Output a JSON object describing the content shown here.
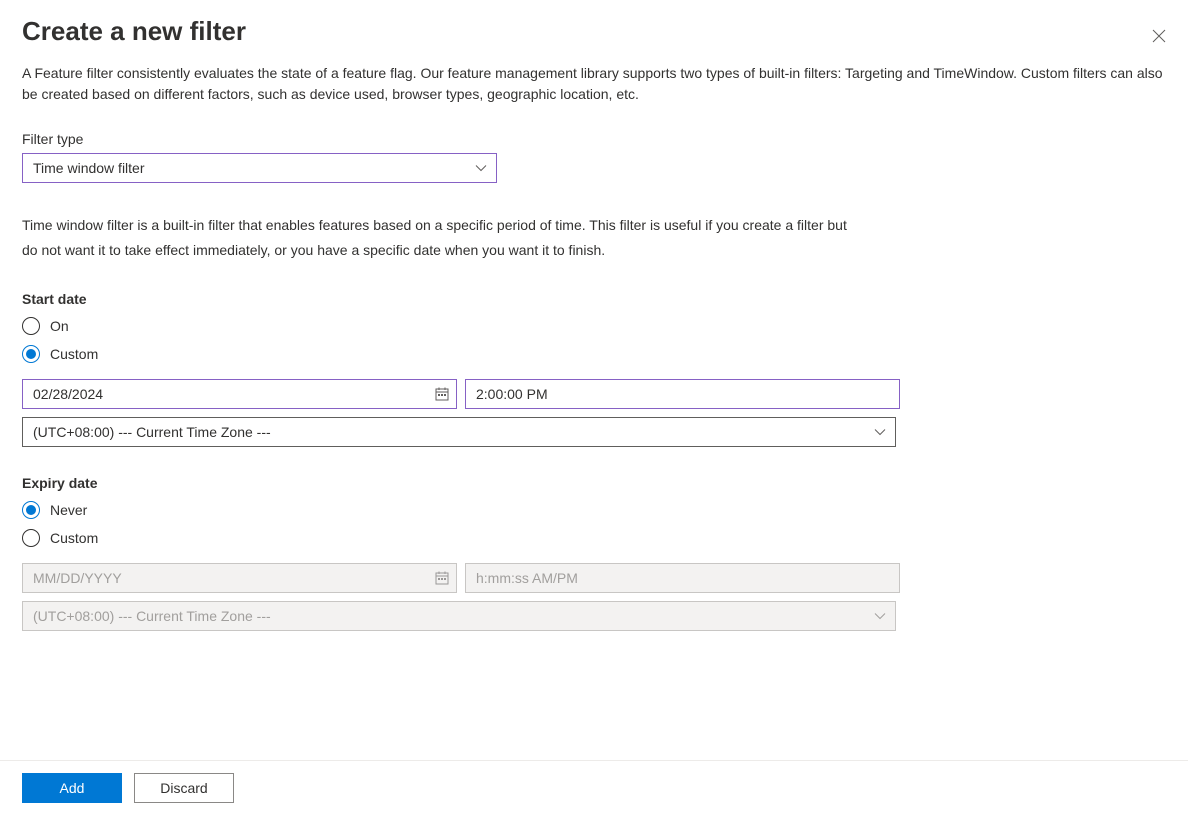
{
  "header": {
    "title": "Create a new filter"
  },
  "description": "A Feature filter consistently evaluates the state of a feature flag. Our feature management library supports two types of built-in filters: Targeting and TimeWindow. Custom filters can also be created based on different factors, such as device used, browser types, geographic location, etc.",
  "filterType": {
    "label": "Filter type",
    "selected": "Time window filter"
  },
  "filterTypeInfo": "Time window filter is a built-in filter that enables features based on a specific period of time. This filter is useful if you create a filter but do not want it to take effect immediately, or you have a specific date when you want it to finish.",
  "startDate": {
    "heading": "Start date",
    "options": {
      "on": "On",
      "custom": "Custom"
    },
    "selected": "custom",
    "dateValue": "02/28/2024",
    "timeValue": "2:00:00 PM",
    "timezone": "(UTC+08:00) --- Current Time Zone ---"
  },
  "expiryDate": {
    "heading": "Expiry date",
    "options": {
      "never": "Never",
      "custom": "Custom"
    },
    "selected": "never",
    "datePlaceholder": "MM/DD/YYYY",
    "timePlaceholder": "h:mm:ss AM/PM",
    "timezone": "(UTC+08:00) --- Current Time Zone ---"
  },
  "footer": {
    "add": "Add",
    "discard": "Discard"
  }
}
